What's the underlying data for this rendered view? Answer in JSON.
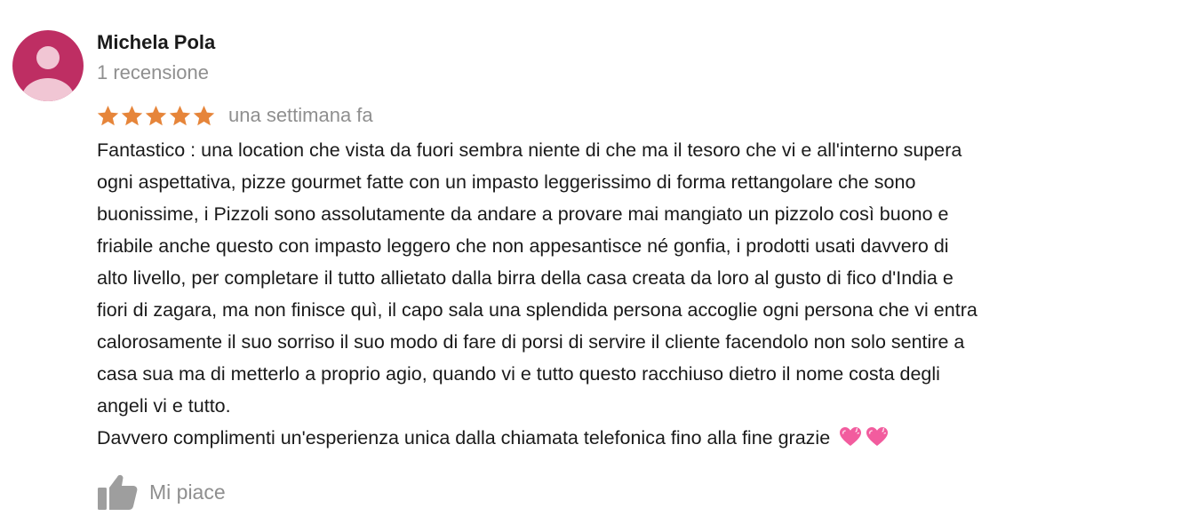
{
  "review": {
    "author": {
      "name": "Michela Pola",
      "meta": "1 recensione",
      "avatar_color": "#be2e63"
    },
    "rating": {
      "stars": 5,
      "max_stars": 5,
      "star_color": "#e6853a"
    },
    "date": "una settimana fa",
    "text_lines": [
      "Fantastico : una location che vista da fuori sembra niente di che ma il tesoro che vi e all'interno supera",
      "ogni aspettativa, pizze gourmet fatte con un impasto leggerissimo di forma rettangolare che sono",
      "buonissime, i Pizzoli sono assolutamente da andare a provare mai mangiato un pizzolo così buono e",
      "friabile anche questo con impasto leggero che non appesantisce né gonfia, i prodotti usati davvero di",
      "alto livello, per completare il tutto allietato dalla birra della casa creata da loro al gusto di fico d'India e",
      "fiori di zagara, ma non finisce quì, il capo sala una splendida persona accoglie ogni persona che vi entra",
      "calorosamente il suo sorriso il suo modo di fare di porsi di servire il cliente facendolo non solo sentire a",
      "casa sua ma di metterlo a proprio agio, quando vi e tutto questo racchiuso dietro il nome costa degli",
      "angeli vi e tutto.",
      "Davvero complimenti un'esperienza unica dalla chiamata telefonica fino alla fine grazie"
    ],
    "emoji_icons": [
      "pink-heart-icon",
      "pink-heart-icon"
    ],
    "like_label": "Mi piace"
  }
}
